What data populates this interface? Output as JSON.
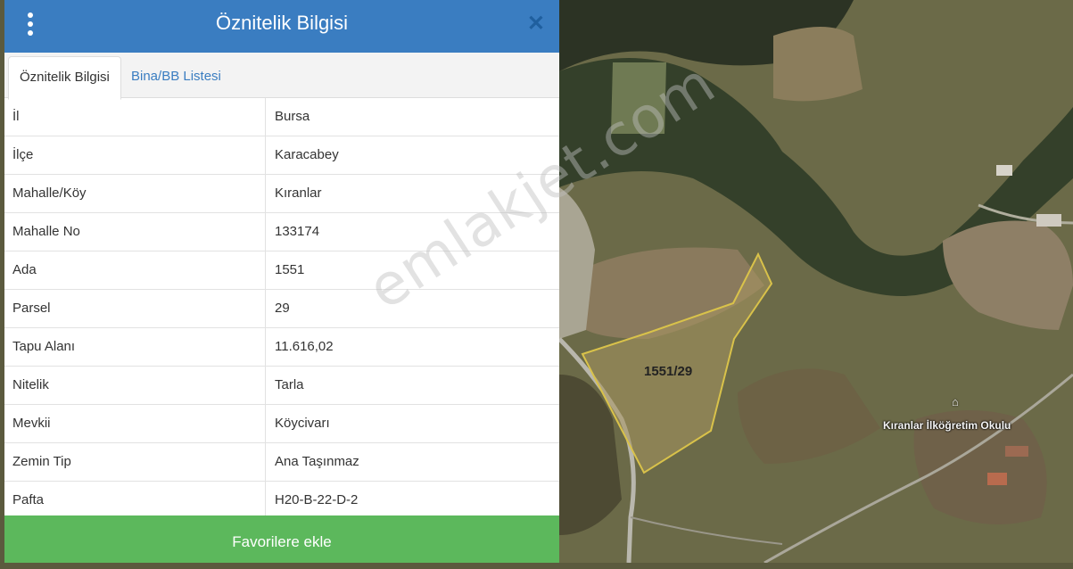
{
  "header": {
    "title": "Öznitelik Bilgisi",
    "menu_icon": "vertical-dots-icon",
    "close_icon": "close-icon"
  },
  "tabs": [
    {
      "label": "Öznitelik Bilgisi",
      "active": true
    },
    {
      "label": "Bina/BB Listesi",
      "active": false
    }
  ],
  "attributes": [
    {
      "key": "İl",
      "value": "Bursa"
    },
    {
      "key": "İlçe",
      "value": "Karacabey"
    },
    {
      "key": "Mahalle/Köy",
      "value": "Kıranlar"
    },
    {
      "key": "Mahalle No",
      "value": "133174"
    },
    {
      "key": "Ada",
      "value": "1551"
    },
    {
      "key": "Parsel",
      "value": "29"
    },
    {
      "key": "Tapu Alanı",
      "value": "11.616,02"
    },
    {
      "key": "Nitelik",
      "value": "Tarla"
    },
    {
      "key": "Mevkii",
      "value": "Köycivarı"
    },
    {
      "key": "Zemin Tip",
      "value": "Ana Taşınmaz"
    },
    {
      "key": "Pafta",
      "value": "H20-B-22-D-2"
    }
  ],
  "favorites_button": "Favorilere ekle",
  "map": {
    "parcel_label": "1551/29",
    "school_label": "Kıranlar İlköğretim Okulu",
    "parcel_outline_color": "#d9c24a"
  },
  "watermark": "emlakjet.com",
  "colors": {
    "header": "#3a7dc1",
    "button": "#5cb85c"
  }
}
